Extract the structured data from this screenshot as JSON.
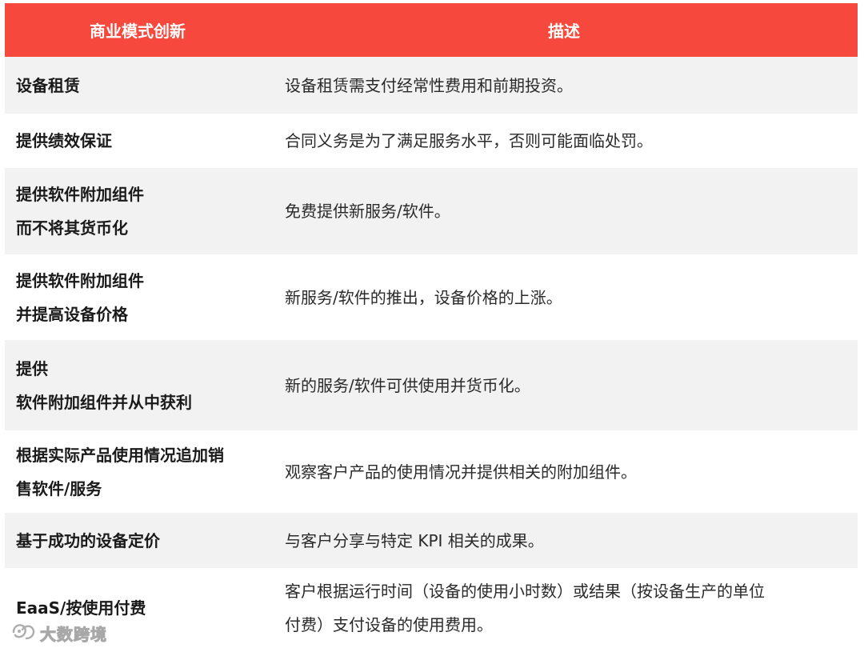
{
  "table": {
    "headers": [
      "商业模式创新",
      "描述"
    ],
    "rows": [
      {
        "model": [
          "设备租赁"
        ],
        "desc": [
          "设备租赁需支付经常性费用和前期投资。"
        ]
      },
      {
        "model": [
          "提供绩效保证"
        ],
        "desc": [
          "合同义务是为了满足服务水平，否则可能面临处罚。"
        ]
      },
      {
        "model": [
          "提供软件附加组件",
          "而不将其货币化"
        ],
        "desc": [
          "免费提供新服务/软件。"
        ]
      },
      {
        "model": [
          "提供软件附加组件",
          "并提高设备价格"
        ],
        "desc": [
          "新服务/软件的推出，设备价格的上涨。"
        ]
      },
      {
        "model": [
          "提供",
          "软件附加组件并从中获利"
        ],
        "desc": [
          "新的服务/软件可供使用并货币化。"
        ]
      },
      {
        "model": [
          "根据实际产品使用情况追加销",
          "售软件/服务"
        ],
        "desc": [
          "观察客户产品的使用情况并提供相关的附加组件。"
        ]
      },
      {
        "model": [
          "基于成功的设备定价"
        ],
        "desc": [
          "与客户分享与特定 KPI 相关的成果。"
        ]
      },
      {
        "model": [
          "EaaS/按使用付费"
        ],
        "desc": [
          "客户根据运行时间（设备的使用小时数）或结果（按设备生产的单位",
          "付费）支付设备的使用费用。"
        ]
      }
    ]
  },
  "watermark": {
    "text": "大数跨境",
    "icon": "brand-logo-icon"
  },
  "colors": {
    "header_bg": "#f6483c",
    "row_alt_bg": "#f2f2f2"
  }
}
